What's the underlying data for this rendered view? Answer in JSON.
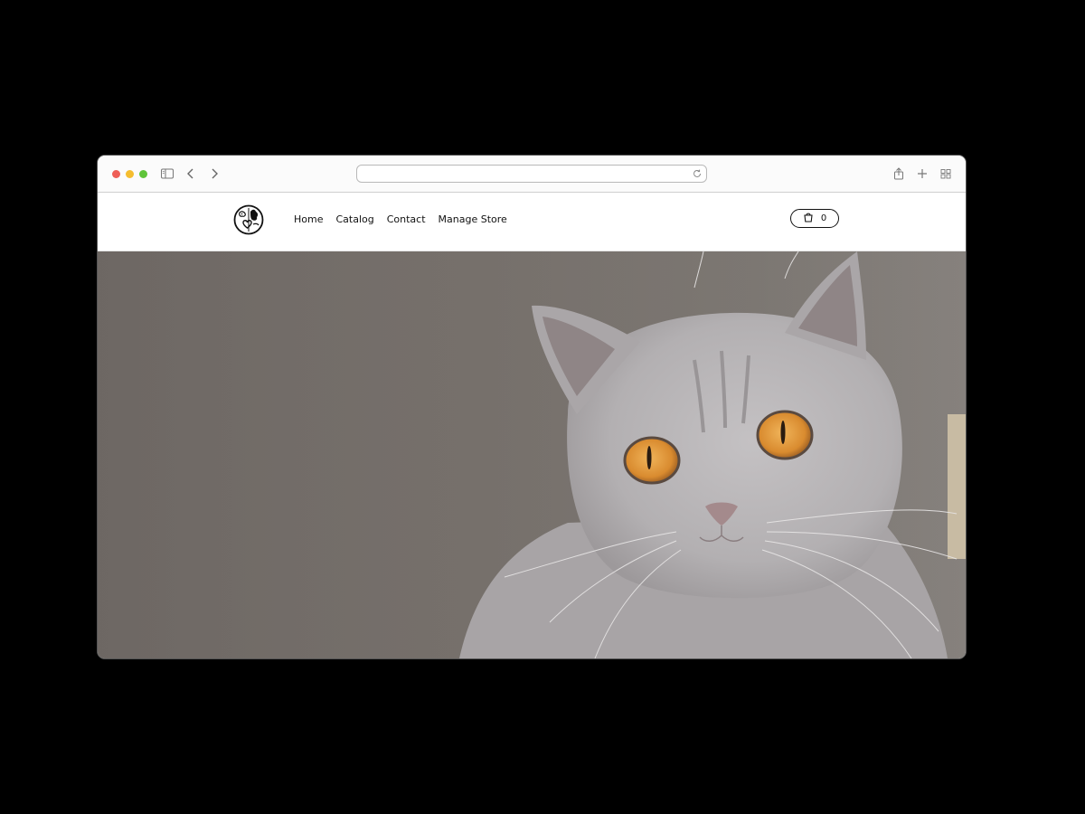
{
  "browser": {
    "address_value": "",
    "icons": [
      "sidebar-icon",
      "back-icon",
      "forward-icon",
      "reload-icon",
      "share-icon",
      "new-tab-icon",
      "tab-overview-icon"
    ]
  },
  "site": {
    "logo_icon": "pet-logo-icon",
    "nav": [
      {
        "label": "Home"
      },
      {
        "label": "Catalog"
      },
      {
        "label": "Contact"
      },
      {
        "label": "Manage Store"
      }
    ],
    "cart": {
      "icon": "shopping-bag-icon",
      "count": "0"
    }
  },
  "hero": {
    "image": "gray-cat-photo"
  },
  "colors": {
    "traffic_red": "#ee5f57",
    "traffic_yellow": "#f5bd2f",
    "traffic_green": "#5fc43a",
    "hero_background": "#746d68",
    "cat_fur": "#b5b2b4",
    "cat_eye": "#d98b2f"
  }
}
